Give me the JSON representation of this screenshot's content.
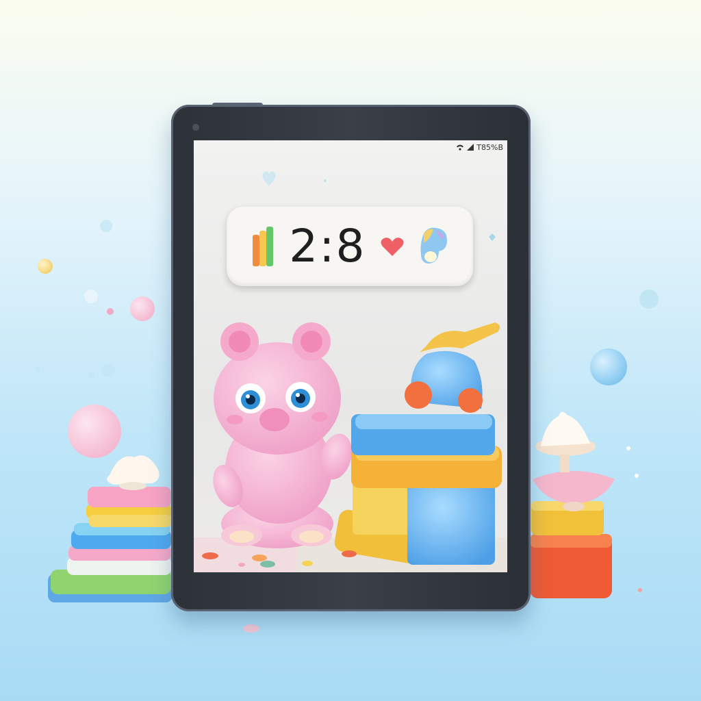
{
  "status_bar": {
    "text": "T85%B",
    "icons": [
      "wifi-icon",
      "signal-icon",
      "battery-icon"
    ]
  },
  "clock_widget": {
    "time": "2:8",
    "left_icon": "color-bars-icon",
    "middle_icon": "heart-icon",
    "right_icon": "blob-icon"
  },
  "characters": [
    "pink-bear-toy",
    "blue-creature-toy"
  ],
  "colors": {
    "background_top": "#fbfdf0",
    "background_bottom": "#a9dbf5",
    "tablet_frame": "#2d3138",
    "screen": "#ededec",
    "bear_pink": "#f4aed2",
    "toy_blue": "#7cc0ee",
    "toy_yellow": "#f6c94e",
    "toy_orange": "#ef7a4a"
  }
}
